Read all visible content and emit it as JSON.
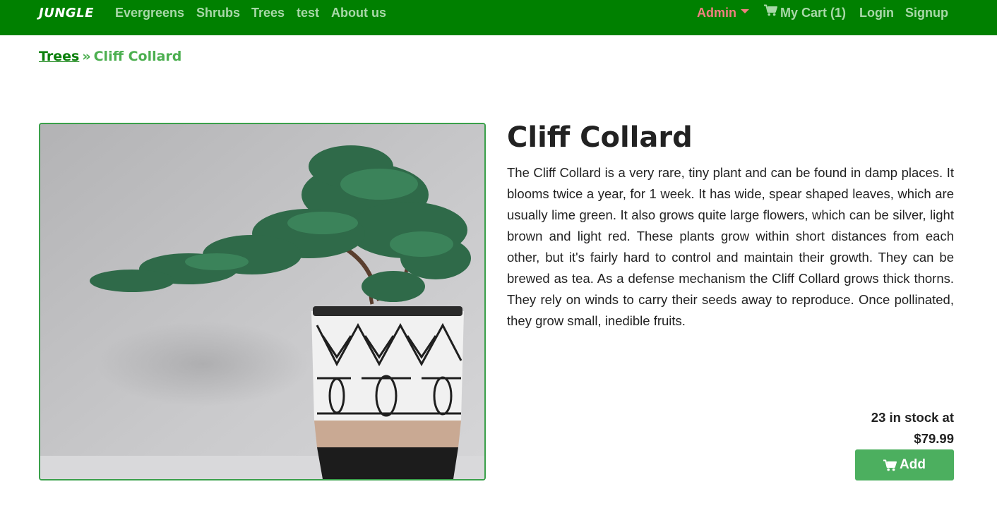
{
  "nav": {
    "brand": "JUNGLE",
    "links": [
      "Evergreens",
      "Shrubs",
      "Trees",
      "test",
      "About us"
    ],
    "admin": "Admin",
    "cart": "My Cart (1)",
    "login": "Login",
    "signup": "Signup"
  },
  "breadcrumb": {
    "parent": "Trees",
    "separator": "»",
    "current": "Cliff Collard"
  },
  "product": {
    "name": "Cliff Collard",
    "description": "The Cliff Collard is a very rare, tiny plant and can be found in damp places. It blooms twice a year, for 1 week. It has wide, spear shaped leaves, which are usually lime green. It also grows quite large flowers, which can be silver, light brown and light red. These plants grow within short distances from each other, but it's fairly hard to control and maintain their growth. They can be brewed as tea. As a defense mechanism the Cliff Collard grows thick thorns. They rely on winds to carry their seeds away to reproduce. Once pollinated, they grow small, inedible fruits.",
    "stock_line": "23 in stock at",
    "price": "$79.99",
    "add_label": "Add",
    "image_icon": "bonsai-photo"
  },
  "colors": {
    "navbar": "#008000",
    "nav_link": "#a8d8a8",
    "admin": "#f08080",
    "accent": "#4caf5f"
  }
}
